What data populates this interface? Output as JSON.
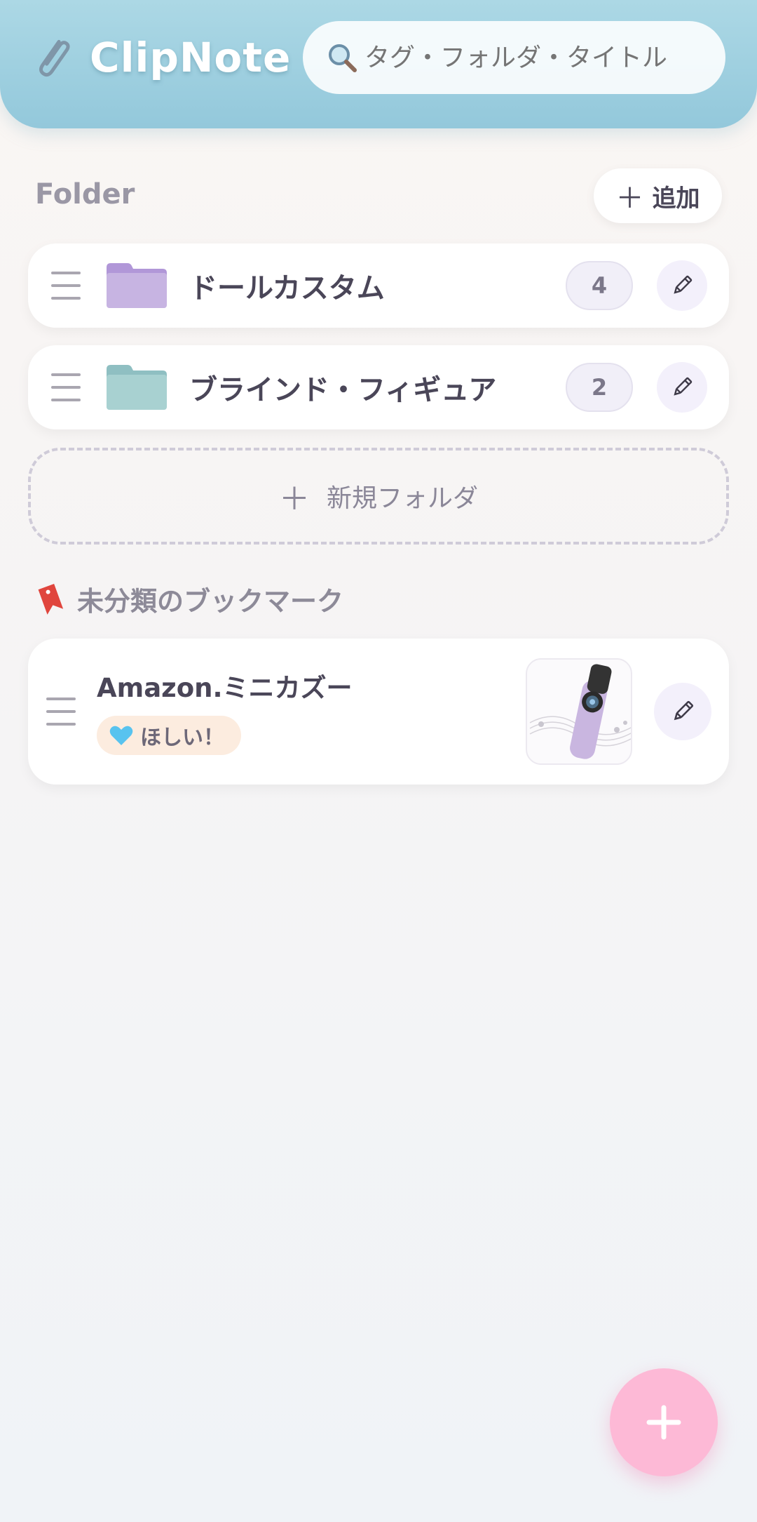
{
  "app": {
    "title": "ClipNote"
  },
  "search": {
    "placeholder": "タグ・フォルダ・タイトル"
  },
  "folders_section": {
    "title": "Folder",
    "add_label": "追加",
    "items": [
      {
        "name": "ドールカスタム",
        "count": "4",
        "color": "#c7b4e2"
      },
      {
        "name": "ブラインド・フィギュア",
        "count": "2",
        "color": "#a8d1d1"
      }
    ],
    "new_folder_label": "新規フォルダ"
  },
  "uncategorized": {
    "title": "未分類のブックマーク",
    "items": [
      {
        "title": "Amazon.ミニカズー",
        "tag": "ほしい！"
      }
    ]
  },
  "colors": {
    "header": "#9fd0e0",
    "fab": "#fdb9d6",
    "tag_bg": "#fcecdf"
  },
  "icons": {
    "logo": "paperclip-icon",
    "search": "magnifier-icon",
    "drag": "drag-handle-icon",
    "edit": "pencil-icon",
    "bookmark": "bookmark-icon",
    "tag": "blue-heart-icon",
    "fab": "plus-icon"
  }
}
